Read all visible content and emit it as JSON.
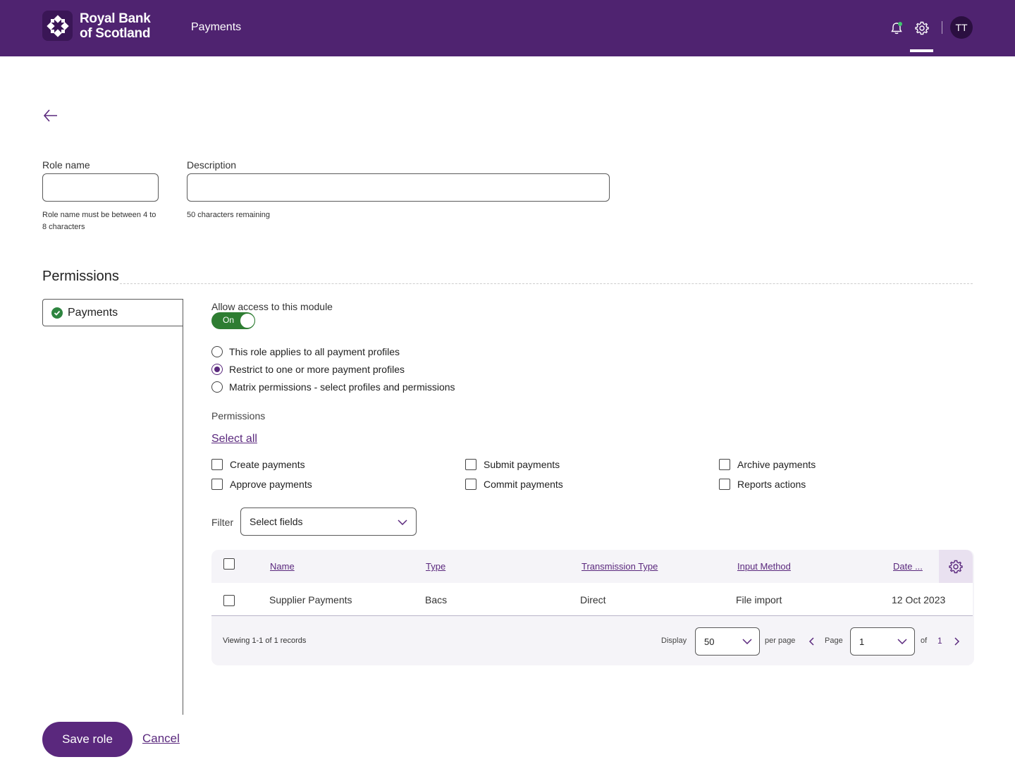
{
  "header": {
    "logo_line1": "Royal Bank",
    "logo_line2": "of Scotland",
    "nav_item": "Payments",
    "avatar_initials": "TT",
    "icons": [
      "bell-icon",
      "gear-icon"
    ],
    "brand_color": "#4f2370"
  },
  "form": {
    "role_name": {
      "label": "Role name",
      "value": "",
      "hint": "Role name must be between 4 to 8 characters"
    },
    "description": {
      "label": "Description",
      "value": "",
      "hint": "50 characters remaining"
    }
  },
  "permissions": {
    "title": "Permissions",
    "side_tab": "Payments",
    "module_access_label": "Allow access to this module",
    "toggle_text": "On",
    "radio_options": [
      {
        "label": "This role applies to all payment profiles",
        "selected": false
      },
      {
        "label": "Restrict to one or more payment profiles",
        "selected": true
      },
      {
        "label": "Matrix permissions - select profiles and permissions",
        "selected": false
      }
    ],
    "permissions_label": "Permissions",
    "select_all": "Select all",
    "checkboxes": [
      {
        "label": "Create payments",
        "checked": false
      },
      {
        "label": "Submit payments",
        "checked": false
      },
      {
        "label": "Archive payments",
        "checked": false
      },
      {
        "label": "Approve payments",
        "checked": false
      },
      {
        "label": "Commit payments",
        "checked": false
      },
      {
        "label": "Reports actions",
        "checked": false
      }
    ],
    "filter_label": "Filter",
    "filter_value": "Select fields"
  },
  "table": {
    "columns": [
      "Name",
      "Type",
      "Transmission Type",
      "Input Method",
      "Date ..."
    ],
    "rows": [
      {
        "name": "Supplier Payments",
        "type": "Bacs",
        "transmission": "Direct",
        "input_method": "File import",
        "date": "12 Oct 2023"
      }
    ],
    "viewing": "Viewing 1-1 of 1 records",
    "display_label": "Display",
    "per_page_value": "50",
    "per_page_label": "per page",
    "page_label": "Page",
    "page_value": "1",
    "of_label": "of",
    "total_pages": "1"
  },
  "actions": {
    "save": "Save role",
    "cancel": "Cancel"
  }
}
